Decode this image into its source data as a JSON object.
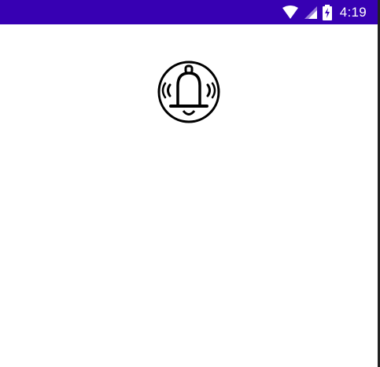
{
  "status_bar": {
    "background_color": "#3700b3",
    "time": "4:19",
    "icons": [
      "wifi-icon",
      "cellular-signal-icon",
      "battery-charging-icon"
    ]
  },
  "main": {
    "bell_icon": "bell-ringing-icon"
  }
}
